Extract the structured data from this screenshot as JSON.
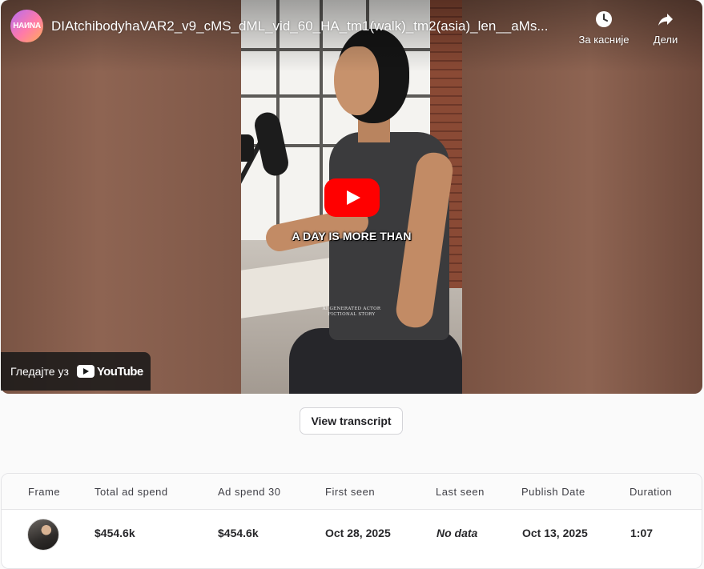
{
  "player": {
    "channel_logo_text": "HAИNA",
    "title": "DIAtchibodyhaVAR2_v9_cMS_dML_vid_60_HA_tm1(walk)_tm2(asia)_len__aMs...",
    "caption": "A DAY IS MORE THAN",
    "watermark_line1": "AI GENERATED ACTOR",
    "watermark_line2": "FICTIONAL STORY",
    "watch_later_label": "За касније",
    "share_label": "Дели",
    "watch_on_label": "Гледајте уз",
    "youtube_word": "YouTube",
    "icons": {
      "watch_later": "clock-icon",
      "share": "share-arrow-icon",
      "play": "play-icon"
    },
    "play_color": "#ff0000"
  },
  "transcript_button": "View transcript",
  "table": {
    "headers": [
      "Frame",
      "Total ad spend",
      "Ad spend 30",
      "First seen",
      "Last seen",
      "Publish Date",
      "Duration"
    ],
    "row": {
      "total_ad_spend": "$454.6k",
      "ad_spend_30": "$454.6k",
      "first_seen": "Oct 28, 2025",
      "last_seen": "No data",
      "publish_date": "Oct 13, 2025",
      "duration": "1:07"
    }
  }
}
